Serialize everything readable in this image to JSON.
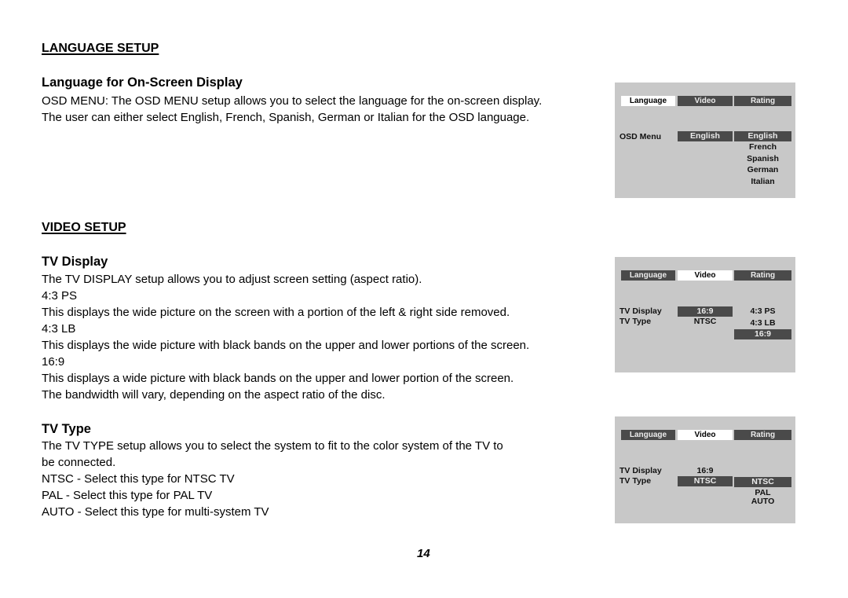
{
  "language_setup": {
    "section_title": "LANGUAGE SETUP",
    "subsection_title": "Language for On-Screen Display",
    "lines": [
      "OSD MENU: The OSD MENU setup allows you to select the language for the on-screen display.",
      "The user can either select English, French, Spanish, German or Italian for the OSD language."
    ]
  },
  "video_setup": {
    "section_title": "VIDEO SETUP",
    "tv_display": {
      "title": "TV Display",
      "lines": [
        "The TV DISPLAY setup allows you to adjust screen setting (aspect ratio).",
        "4:3 PS",
        "This displays the wide picture on the screen with a portion of the left & right side removed.",
        "4:3 LB",
        "This displays the wide picture with black bands on the upper and lower portions of the screen.",
        "16:9",
        "This displays a wide picture with black bands on the upper and lower portion of the screen.",
        "The bandwidth will vary, depending on the aspect ratio of the disc."
      ]
    },
    "tv_type": {
      "title": "TV Type",
      "lines": [
        "The TV TYPE setup allows you to select the system to fit to the color system of the TV to",
        "be connected.",
        "NTSC - Select this type for NTSC TV",
        "PAL - Select this type for PAL TV",
        "AUTO - Select this type for multi-system TV"
      ]
    }
  },
  "osd_panels": {
    "tabs": [
      "Language",
      "Video",
      "Rating"
    ],
    "language_panel": {
      "active_tab": "Language",
      "setting_label": "OSD Menu",
      "current_value": "English",
      "options": [
        "English",
        "French",
        "Spanish",
        "German",
        "Italian"
      ],
      "highlighted_option": "English"
    },
    "tv_display_panel": {
      "active_tab": "Video",
      "settings": [
        {
          "label": "TV Display",
          "value": "16:9"
        },
        {
          "label": "TV Type",
          "value": "NTSC"
        }
      ],
      "focused_setting": "TV Display",
      "options": [
        "4:3 PS",
        "4:3 LB",
        "16:9"
      ],
      "highlighted_option": "16:9"
    },
    "tv_type_panel": {
      "active_tab": "Video",
      "settings": [
        {
          "label": "TV Display",
          "value": "16:9"
        },
        {
          "label": "TV Type",
          "value": "NTSC"
        }
      ],
      "focused_setting": "TV Type",
      "options": [
        "NTSC",
        "PAL",
        "AUTO"
      ],
      "highlighted_option": "NTSC"
    }
  },
  "page_number": "14",
  "colors": {
    "panel_background": "#c8c8c8",
    "highlight_dark": "#4a4a4a",
    "active_tab": "#ffffff"
  }
}
